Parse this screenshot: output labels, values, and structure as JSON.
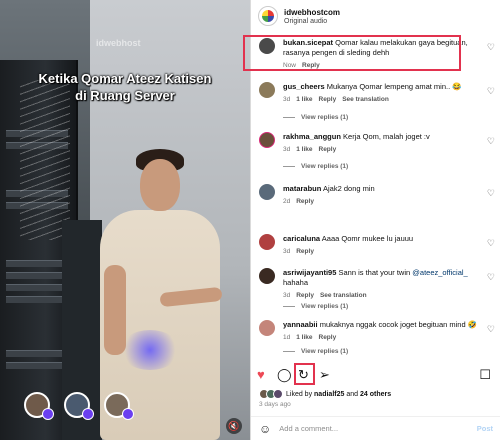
{
  "video": {
    "watermark": "idwebhost",
    "caption_line1": "Ketika Qomar Ateez Katisen",
    "caption_line2": "di Ruang Server"
  },
  "header": {
    "account_name": "idwebhostcom",
    "audio_label": "Original audio"
  },
  "comments": [
    {
      "user": "bukan.sicepat",
      "text": "Qomar kalau melakukan gaya begituan, rasanya pengen di sleding dehh",
      "time": "Now",
      "likes": "",
      "reply": "Reply",
      "translation": "",
      "view_replies": ""
    },
    {
      "user": "gus_cheers",
      "text": "Mukanya Qomar lempeng amat min.. 😂",
      "time": "3d",
      "likes": "1 like",
      "reply": "Reply",
      "translation": "See translation",
      "view_replies": "View replies (1)"
    },
    {
      "user": "rakhma_anggun",
      "text": "Kerja Qom, malah joget :v",
      "time": "3d",
      "likes": "1 like",
      "reply": "Reply",
      "translation": "",
      "view_replies": "View replies (1)"
    },
    {
      "user": "matarabun",
      "text": "Ajak2 dong min",
      "time": "2d",
      "likes": "",
      "reply": "Reply",
      "translation": "",
      "view_replies": ""
    },
    {
      "user": "caricaluna",
      "text": "Aaaa Qomr mukee lu jauuu",
      "time": "3d",
      "likes": "",
      "reply": "Reply",
      "translation": "",
      "view_replies": ""
    },
    {
      "user": "asriwijayanti95",
      "text": "Sann is that your twin",
      "mention": "@ateez_official_",
      "after": " hahaha",
      "time": "3d",
      "likes": "",
      "reply": "Reply",
      "translation": "See translation",
      "view_replies": "View replies (1)"
    },
    {
      "user": "yannaabii",
      "text": "mukaknya nggak cocok joget begituan mind 🤣",
      "time": "1d",
      "likes": "1 like",
      "reply": "Reply",
      "translation": "",
      "view_replies": "View replies (1)"
    }
  ],
  "likes_bar": {
    "prefix": "Liked by",
    "user": "nadialf25",
    "and": "and",
    "others": "24 others",
    "ago": "3 days ago"
  },
  "add_comment": {
    "placeholder": "Add a comment...",
    "post_label": "Post"
  },
  "colors": {
    "highlight": "#e2324e",
    "like_red": "#ed4956",
    "link_blue": "#00376b"
  }
}
